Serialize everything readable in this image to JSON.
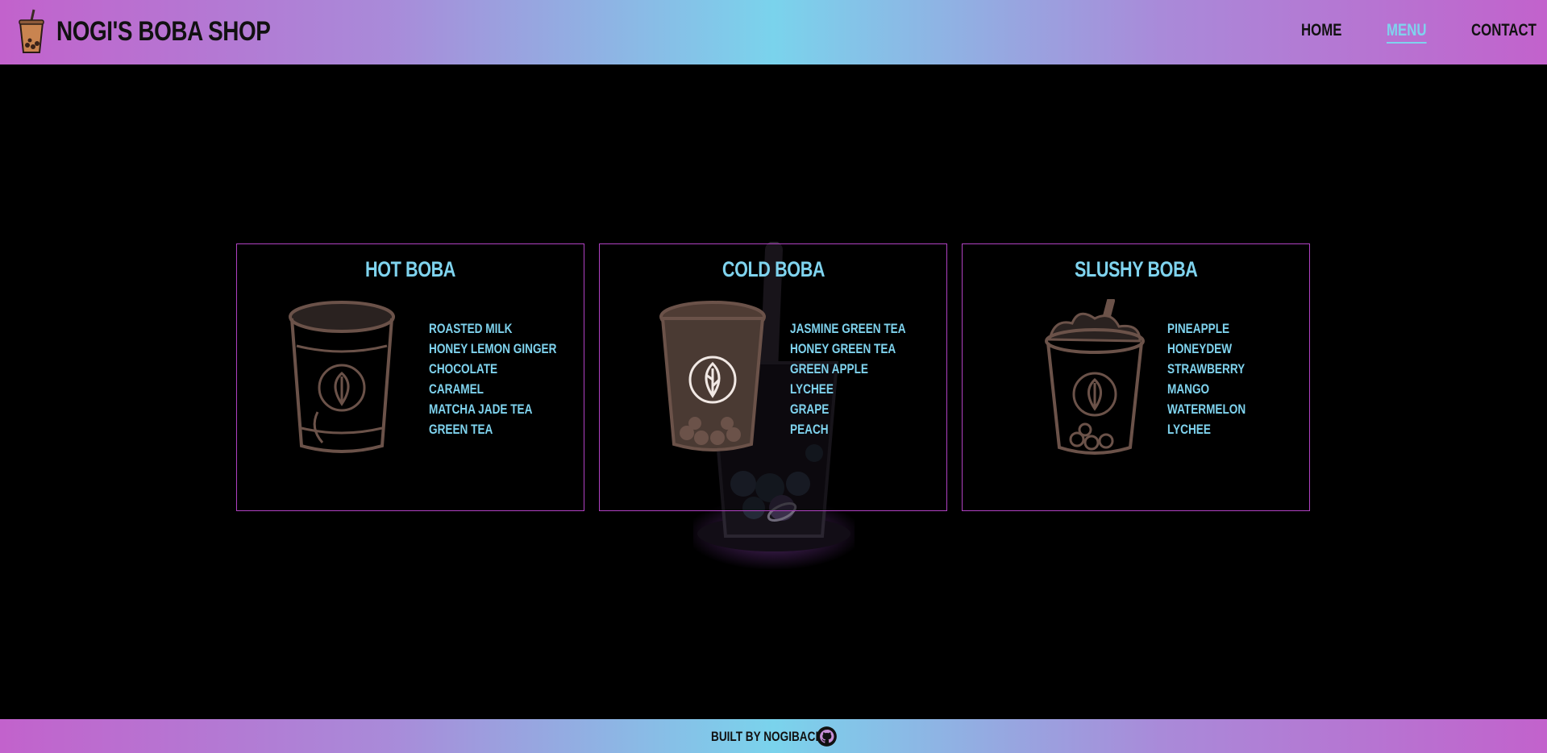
{
  "header": {
    "title": "NOGI'S BOBA SHOP",
    "nav": [
      {
        "label": "HOME"
      },
      {
        "label": "MENU",
        "active": true
      },
      {
        "label": "CONTACT"
      }
    ]
  },
  "menu": {
    "cards": [
      {
        "title": "HOT BOBA",
        "icon": "hot-boba-cup-icon",
        "items": [
          "ROASTED MILK",
          "HONEY LEMON GINGER",
          "CHOCOLATE",
          "CARAMEL",
          "MATCHA JADE TEA",
          "GREEN TEA"
        ]
      },
      {
        "title": "COLD BOBA",
        "icon": "cold-boba-cup-icon",
        "items": [
          "JASMINE GREEN TEA",
          "HONEY GREEN TEA",
          "GREEN APPLE",
          "LYCHEE",
          "GRAPE",
          "PEACH"
        ]
      },
      {
        "title": "SLUSHY BOBA",
        "icon": "slushy-boba-cup-icon",
        "items": [
          "PINEAPPLE",
          "HONEYDEW",
          "STRAWBERRY",
          "MANGO",
          "WATERMELON",
          "LYCHEE"
        ]
      }
    ]
  },
  "footer": {
    "text": "BUILT BY NOGIBACK",
    "icon": "github-icon"
  },
  "colors": {
    "accent": "#7fd3ee",
    "card_border": "#b041c2",
    "gradient_pink": "#c262cc",
    "gradient_blue": "#7ad3ec",
    "cup_brown": "#6b5249"
  }
}
